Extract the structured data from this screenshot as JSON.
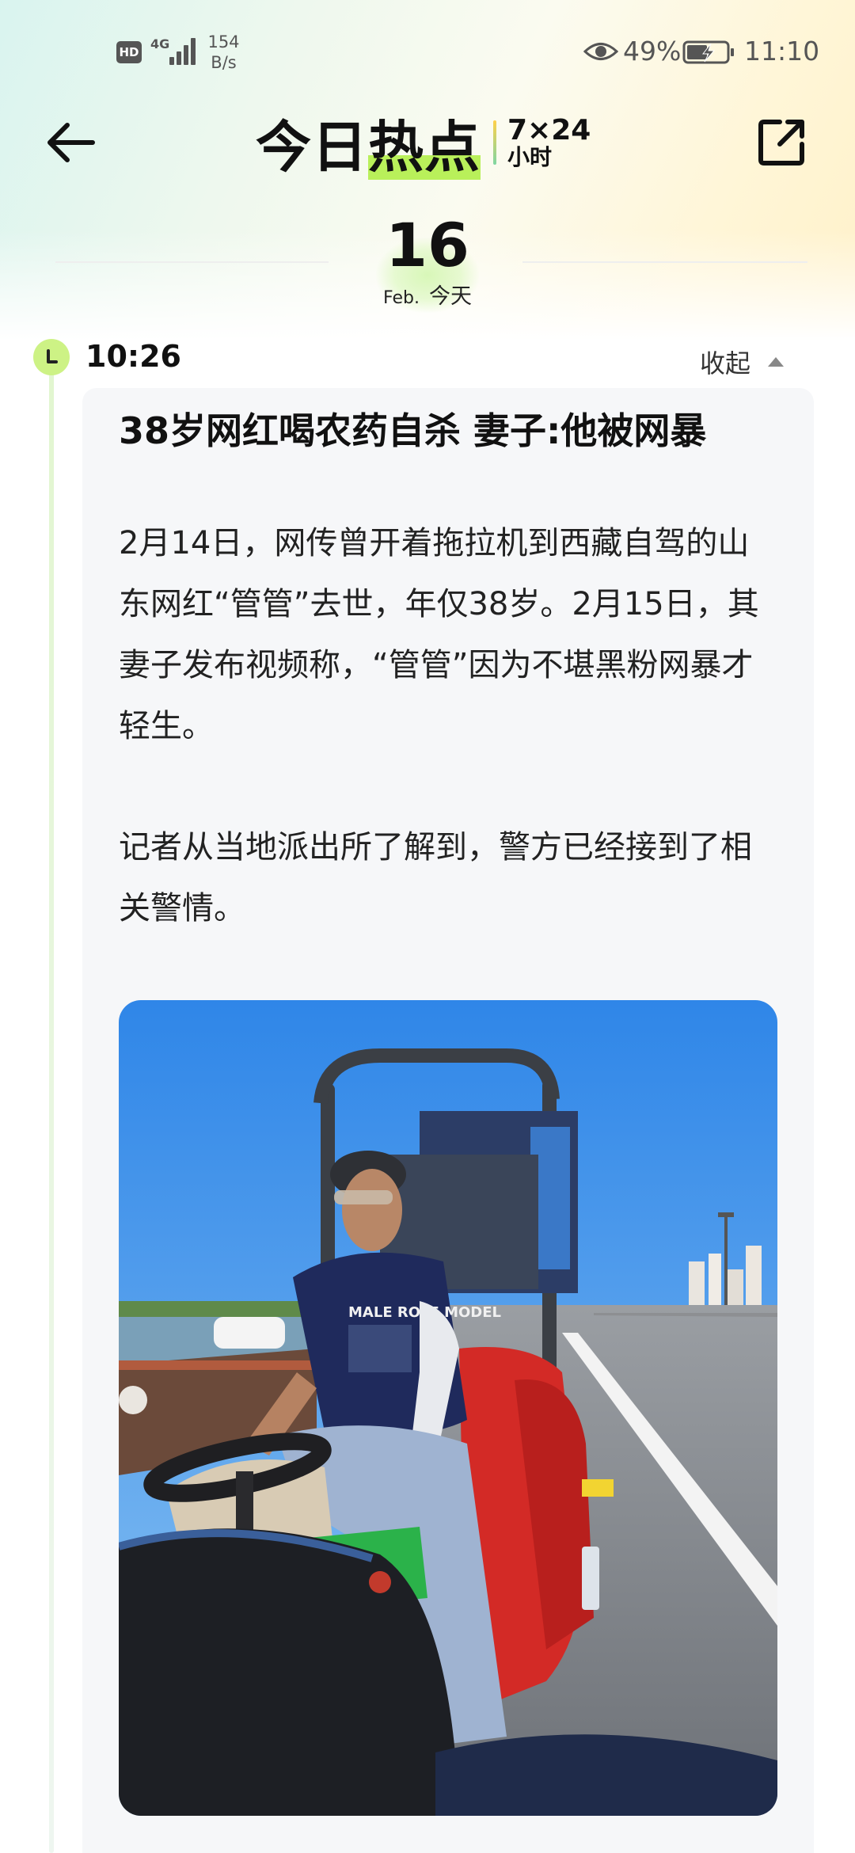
{
  "status_bar": {
    "hd": "HD",
    "network": "4G",
    "speed_value": "154",
    "speed_unit": "B/s",
    "battery": "49%",
    "time": "11:10",
    "icons": [
      "hd-icon",
      "signal-icon",
      "eye-comfort-icon",
      "battery-charging-icon"
    ]
  },
  "nav": {
    "brand_part1": "今日",
    "brand_part2": "热点",
    "brand_part3": "7×24",
    "brand_part4": "小时",
    "icons": [
      "back-arrow-icon",
      "share-icon"
    ]
  },
  "date": {
    "day": "16",
    "month": "Feb.",
    "label": "今天"
  },
  "entry": {
    "time": "10:26",
    "collapse_label": "收起",
    "headline": "38岁网红喝农药自杀 妻子:他被网暴",
    "paragraph1": "2月14日，网传曾开着拖拉机到西藏自驾的山东网红“管管”去世，年仅38岁。2月15日，其妻子发布视频称，“管管”因为不堪黑粉网暴才轻生。",
    "paragraph2": "记者从当地派出所了解到，警方已经接到了相关警情。",
    "photo_shirt_text": "MALE ROLE MODEL"
  },
  "colors": {
    "accent_green": "#cdf285",
    "card_bg": "#f6f7f9",
    "text_primary": "#111111"
  }
}
